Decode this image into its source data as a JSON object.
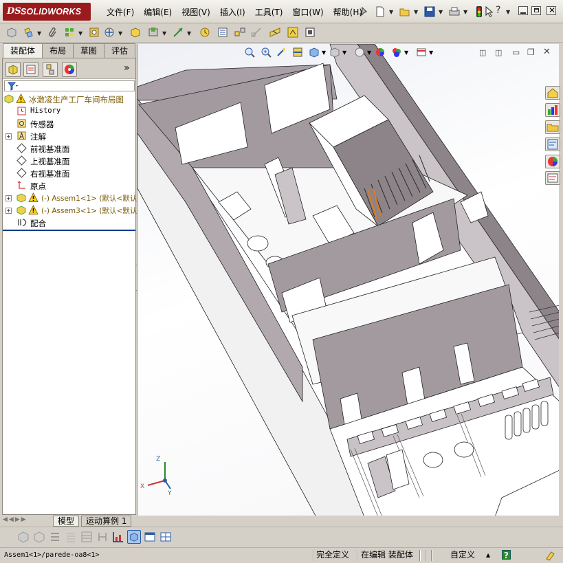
{
  "app": {
    "brand_prefix": "DS",
    "brand_name": "SOLIDWORKS"
  },
  "menu": {
    "items": [
      "文件(F)",
      "编辑(E)",
      "视图(V)",
      "插入(I)",
      "工具(T)",
      "窗口(W)",
      "帮助(H)"
    ]
  },
  "tabs": [
    "装配体",
    "布局",
    "草图",
    "评估"
  ],
  "feature_tree": {
    "root": "冰激凌生产工厂车间布局图",
    "items": [
      {
        "label": "History",
        "icon": "history-icon",
        "expand": ""
      },
      {
        "label": "传感器",
        "icon": "sensor-icon",
        "expand": ""
      },
      {
        "label": "注解",
        "icon": "annotation-icon",
        "expand": "+"
      },
      {
        "label": "前视基准面",
        "icon": "plane-icon",
        "expand": ""
      },
      {
        "label": "上视基准面",
        "icon": "plane-icon",
        "expand": ""
      },
      {
        "label": "右视基准面",
        "icon": "plane-icon",
        "expand": ""
      },
      {
        "label": "原点",
        "icon": "origin-icon",
        "expand": ""
      },
      {
        "label": "(-) Assem1<1> (默认<默认",
        "icon": "subassembly-icon",
        "expand": "+"
      },
      {
        "label": "(-) Assem3<1> (默认<默认",
        "icon": "subassembly-icon",
        "expand": "+"
      },
      {
        "label": "配合",
        "icon": "mates-icon",
        "expand": ""
      }
    ]
  },
  "bottom_tabs": [
    "模型",
    "运动算例 1"
  ],
  "status": {
    "path": "Assem1<1>/parede-oa8<1>",
    "definition": "完全定义",
    "mode": "在编辑 装配体",
    "units": "自定义",
    "help": "?"
  },
  "triad": {
    "x": "X",
    "y": "Y",
    "z": "Z"
  },
  "colors": {
    "brand": "#9a1b1e",
    "wall": "#a8a0a6",
    "wall_dark": "#7c747a",
    "floor": "#f7f7f7",
    "accent_orange": "#e07a1c",
    "selection_blue": "#0a3a8c"
  }
}
